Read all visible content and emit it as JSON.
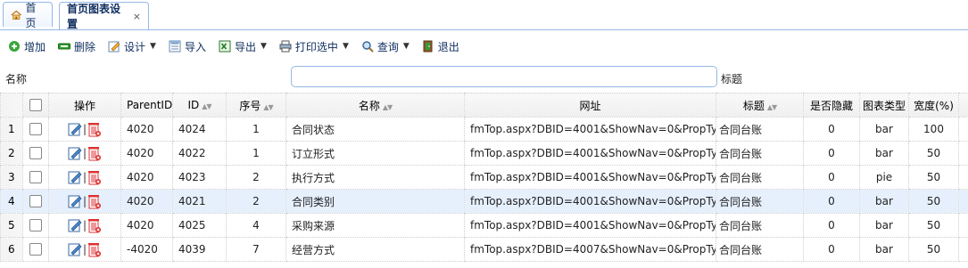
{
  "tabs": [
    {
      "label": "首页"
    },
    {
      "label": "首页图表设置",
      "close": "×"
    }
  ],
  "toolbar": {
    "add": "增加",
    "delete": "删除",
    "design": "设计",
    "import": "导入",
    "export": "导出",
    "print": "打印选中",
    "query": "查询",
    "exit": "退出"
  },
  "search": {
    "name_label": "名称",
    "title_label": "标题",
    "value": ""
  },
  "columns": {
    "op": "操作",
    "parentid": "ParentID",
    "id": "ID",
    "seq": "序号",
    "name": "名称",
    "url": "网址",
    "title": "标题",
    "hidden": "是否隐藏",
    "chart_type": "图表类型",
    "width": "宽度(%)"
  },
  "rows": [
    {
      "n": "1",
      "parentid": "4020",
      "id": "4024",
      "seq": "1",
      "name": "合同状态",
      "url": "fmTop.aspx?DBID=4001&ShowNav=0&PropTy",
      "title": "合同台账",
      "hidden": "0",
      "type": "bar",
      "width": "100"
    },
    {
      "n": "2",
      "parentid": "4020",
      "id": "4022",
      "seq": "1",
      "name": "订立形式",
      "url": "fmTop.aspx?DBID=4001&ShowNav=0&PropTy",
      "title": "合同台账",
      "hidden": "0",
      "type": "bar",
      "width": "50"
    },
    {
      "n": "3",
      "parentid": "4020",
      "id": "4023",
      "seq": "2",
      "name": "执行方式",
      "url": "fmTop.aspx?DBID=4001&ShowNav=0&PropTy",
      "title": "合同台账",
      "hidden": "0",
      "type": "pie",
      "width": "50"
    },
    {
      "n": "4",
      "parentid": "4020",
      "id": "4021",
      "seq": "2",
      "name": "合同类别",
      "url": "fmTop.aspx?DBID=4001&ShowNav=0&PropTy",
      "title": "合同台账",
      "hidden": "0",
      "type": "bar",
      "width": "50"
    },
    {
      "n": "5",
      "parentid": "4020",
      "id": "4025",
      "seq": "4",
      "name": "采购来源",
      "url": "fmTop.aspx?DBID=4001&ShowNav=0&PropTy",
      "title": "合同台账",
      "hidden": "0",
      "type": "bar",
      "width": "50"
    },
    {
      "n": "6",
      "parentid": "-4020",
      "id": "4039",
      "seq": "7",
      "name": "经营方式",
      "url": "fmTop.aspx?DBID=4007&ShowNav=0&PropTy",
      "title": "合同台账",
      "hidden": "0",
      "type": "bar",
      "width": "50"
    }
  ],
  "icons": {
    "home": "home-icon",
    "add": "add-circle-icon",
    "delete": "minus-icon",
    "design": "pencil-icon",
    "import": "import-icon",
    "export": "excel-icon",
    "print": "printer-icon",
    "query": "magnifier-icon",
    "exit": "exit-door-icon",
    "edit": "edit-icon",
    "trash": "trash-icon"
  },
  "colors": {
    "accent": "#95b8e7",
    "link": "#0e2d5f",
    "highlight": "#e6f0fd",
    "danger": "#d33"
  }
}
